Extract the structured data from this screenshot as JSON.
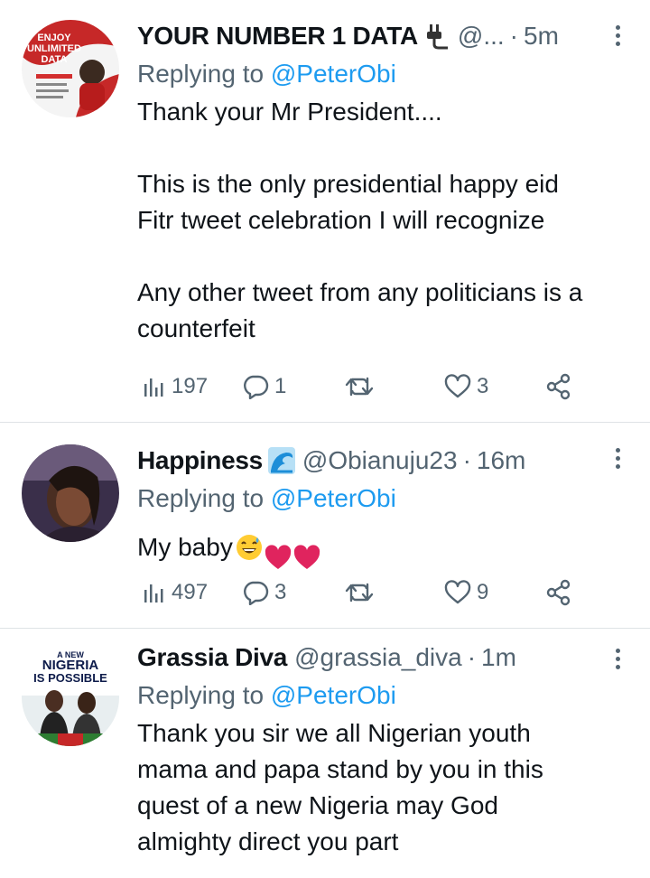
{
  "tweets": [
    {
      "name": "YOUR NUMBER 1 DATA",
      "handle": "@...",
      "time": "5m",
      "replying_label": "Replying to",
      "replying_to": "@PeterObi",
      "body": "Thank your Mr President....\n\nThis is the only presidential happy  eid\nFitr tweet celebration I will recognize\n\nAny other tweet from any politicians is a\ncounterfeit",
      "views": "197",
      "replies": "1",
      "retweets": "",
      "likes": "3",
      "avatar_text": "ENJOY UNLIMITED DATA",
      "badge_icon": "plug-icon"
    },
    {
      "name": "Happiness",
      "handle": "@Obianuju23",
      "time": "16m",
      "replying_label": "Replying to",
      "replying_to": "@PeterObi",
      "body": "My baby",
      "views": "497",
      "replies": "3",
      "retweets": "",
      "likes": "9",
      "badge_icon": "wave-icon"
    },
    {
      "name": "Grassia Diva",
      "handle": "@grassia_diva",
      "time": "1m",
      "replying_label": "Replying to",
      "replying_to": "@PeterObi",
      "body": "Thank you sir we all Nigerian youth\nmama and papa stand by you in this\nquest of a new Nigeria may God\nalmighty direct you part",
      "avatar_text_top": "A NEW",
      "avatar_text_mid": "NIGERIA",
      "avatar_text_bot": "IS POSSIBLE"
    }
  ],
  "colors": {
    "link": "#1d9bf0",
    "muted": "#536471",
    "text": "#0f1419",
    "heart": "#e0245e",
    "divider": "#dfe3e6"
  }
}
